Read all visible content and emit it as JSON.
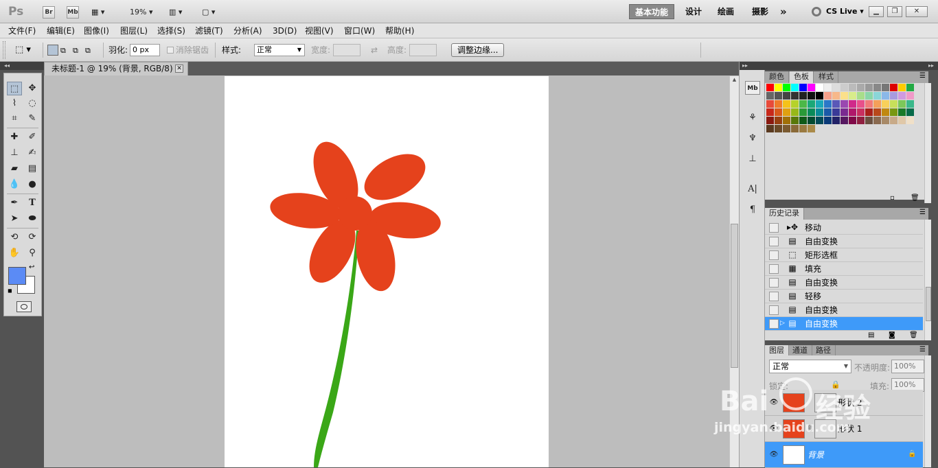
{
  "appbar": {
    "logo": "Ps",
    "br": "Br",
    "mb": "Mb",
    "zoom": "19%",
    "workspaces": [
      "基本功能",
      "设计",
      "绘画",
      "摄影"
    ],
    "more": "»",
    "cslive": "CS Live"
  },
  "menu": [
    "文件(F)",
    "编辑(E)",
    "图像(I)",
    "图层(L)",
    "选择(S)",
    "滤镜(T)",
    "分析(A)",
    "3D(D)",
    "视图(V)",
    "窗口(W)",
    "帮助(H)"
  ],
  "options": {
    "feather_label": "羽化:",
    "feather_value": "0 px",
    "antialias_label": "消除锯齿",
    "style_label": "样式:",
    "style_value": "正常",
    "width_label": "宽度:",
    "height_label": "高度:",
    "refine_button": "调整边缘..."
  },
  "document": {
    "tab_title": "未标题-1 @ 19% (背景, RGB/8) *"
  },
  "swatch_panel": {
    "tabs": [
      "颜色",
      "色板",
      "样式"
    ],
    "active_tab": "色板"
  },
  "history": {
    "tab": "历史记录",
    "items": [
      "移动",
      "自由变换",
      "矩形选框",
      "填充",
      "自由变换",
      "轻移",
      "自由变换",
      "自由变换"
    ],
    "selected_index": 7
  },
  "layers": {
    "tabs": [
      "图层",
      "通道",
      "路径"
    ],
    "blend_mode": "正常",
    "opacity_label": "不透明度:",
    "opacity_value": "100%",
    "lock_label": "锁定:",
    "fill_label": "填充:",
    "fill_value": "100%",
    "rows": [
      "形状 2",
      "形状 1",
      "背景"
    ],
    "selected": "背景"
  },
  "watermark": {
    "brand": "Bai",
    "brand_cn": "经验",
    "url": "jingyan.baidu.com"
  },
  "colors": {
    "foreground": "#5b8bf5",
    "background": "#ffffff",
    "flower": "#e5421c",
    "stem": "#3aa717",
    "selection": "#3e9af9"
  }
}
